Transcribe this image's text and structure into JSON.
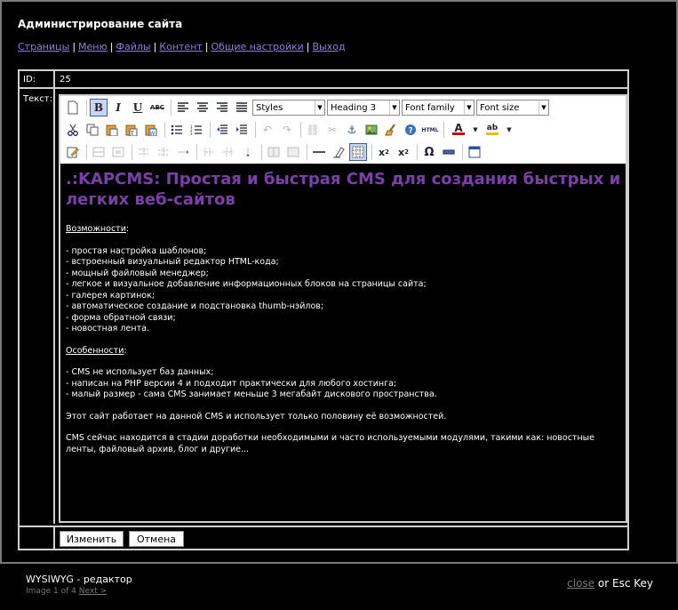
{
  "site": {
    "title": "Администрирование сайта",
    "nav": [
      "Страницы",
      "Меню",
      "Файлы",
      "Контент",
      "Общие настройки",
      "Выход"
    ],
    "nav_separator": "|"
  },
  "form": {
    "id_label": "ID:",
    "id_value": "25",
    "text_label": "Текст:",
    "save_button": "Изменить",
    "cancel_button": "Отмена"
  },
  "toolbar": {
    "styles": "Styles",
    "format": "Heading 3",
    "font_family": "Font family",
    "font_size": "Font size",
    "icons_row1": [
      "new-document-icon",
      "bold-icon",
      "italic-icon",
      "underline-icon",
      "strikethrough-icon",
      "align-left-icon",
      "align-center-icon",
      "align-right-icon",
      "align-justify-icon"
    ],
    "icons_row2": [
      "cut-icon",
      "copy-icon",
      "paste-icon",
      "paste-text-icon",
      "paste-word-icon",
      "bullet-list-icon",
      "numbered-list-icon",
      "outdent-icon",
      "indent-icon",
      "undo-icon",
      "redo-icon",
      "link-icon",
      "unlink-icon",
      "anchor-icon",
      "image-icon",
      "cleanup-icon",
      "help-icon",
      "html-source-icon",
      "text-color-icon",
      "background-color-icon"
    ],
    "icons_row3": [
      "edit-css-icon",
      "table-row-props-icon",
      "table-cell-props-icon",
      "insert-row-before-icon",
      "insert-row-after-icon",
      "delete-row-icon",
      "insert-col-before-icon",
      "insert-col-after-icon",
      "delete-col-icon",
      "split-cells-icon",
      "merge-cells-icon",
      "horizontal-rule-icon",
      "remove-format-icon",
      "visual-aid-icon",
      "subscript-icon",
      "superscript-icon",
      "special-char-icon",
      "media-icon",
      "fullscreen-icon"
    ],
    "html_label": "HTML",
    "text_color_label": "A",
    "bg_color_label": "ab",
    "text_color": "#cc0000",
    "bg_color": "#e0c000"
  },
  "content": {
    "heading": ".:KAPCMS: Простая и быстрая CMS для создания быстрых и легких веб-сайтов",
    "heading_color": "#7a40a8",
    "features_title": "Возможности",
    "features": [
      "- простая настройка шаблонов;",
      "- встроенный визуальный редактор HTML-кода;",
      "- мощный файловый менеджер;",
      "- легкое и визуальное добавление информационных блоков на страницы сайта;",
      "- галерея картинок;",
      "- автоматическое создание и подстановка thumb-нэйлов;",
      "- форма обратной связи;",
      "- новостная лента."
    ],
    "specifics_title": "Особенности",
    "specifics": [
      "- CMS не использует баз данных;",
      "- написан на PHP версии 4 и подходит практически для любого хостинга;",
      "- малый размер - сама CMS занимает меньше 3 мегабайт дискового пространства."
    ],
    "paragraph1": "Этот сайт работает на данной CMS и использует только половину её возможностей.",
    "paragraph2": "CMS сейчас находится в стадии доработки необходимыми и часто используемыми модулями, такими как: новостные ленты, файловый архив, блог и другие..."
  },
  "lightbox": {
    "caption": "WYSIWYG - редактор",
    "counter": "Image 1 of 4",
    "next": "Next >",
    "close": "close",
    "close_suffix": "or Esc Key"
  }
}
